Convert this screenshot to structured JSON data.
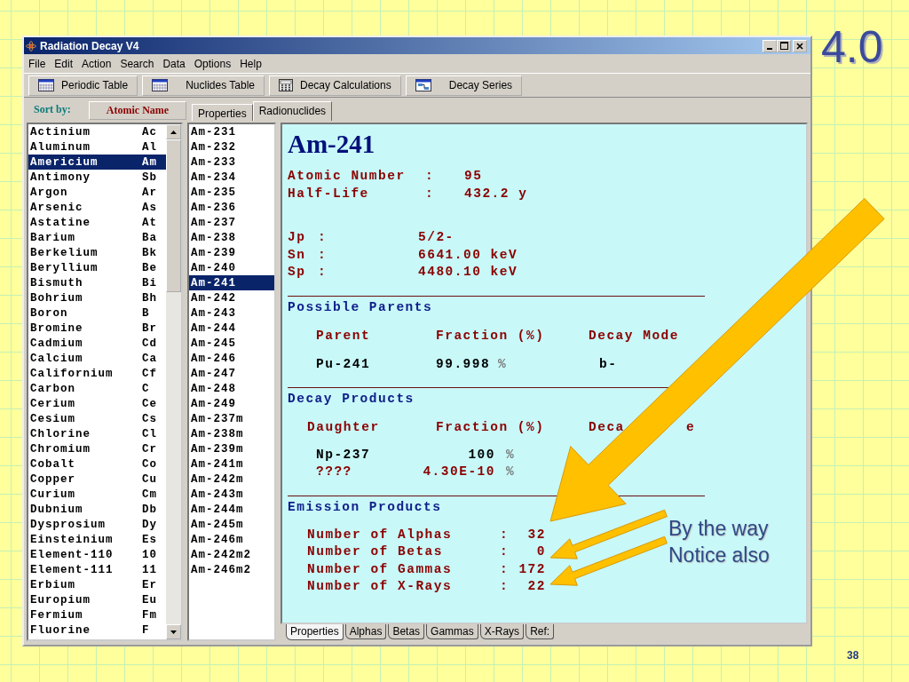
{
  "slide": {
    "heading": "4.0",
    "notes": [
      "By the way",
      "Notice also"
    ],
    "page_number": "38"
  },
  "window": {
    "title": "Radiation Decay V4",
    "menu": [
      "File",
      "Edit",
      "Action",
      "Search",
      "Data",
      "Options",
      "Help"
    ],
    "toolbar": [
      {
        "label": "Periodic Table",
        "kind": "table"
      },
      {
        "label": "Nuclides Table",
        "kind": "table"
      },
      {
        "label": "Decay Calculations",
        "kind": "calculator"
      },
      {
        "label": "Decay Series",
        "kind": "chart"
      }
    ],
    "sort": {
      "label": "Sort by:",
      "button": "Atomic Name"
    },
    "tabs": [
      {
        "label": "Properties",
        "selected": false
      },
      {
        "label": "Radionuclides",
        "selected": true
      }
    ],
    "elements": [
      {
        "name": "Actinium",
        "symbol": "Ac",
        "selected": false
      },
      {
        "name": "Aluminum",
        "symbol": "Al",
        "selected": false
      },
      {
        "name": "Americium",
        "symbol": "Am",
        "selected": true
      },
      {
        "name": "Antimony",
        "symbol": "Sb",
        "selected": false
      },
      {
        "name": "Argon",
        "symbol": "Ar",
        "selected": false
      },
      {
        "name": "Arsenic",
        "symbol": "As",
        "selected": false
      },
      {
        "name": "Astatine",
        "symbol": "At",
        "selected": false
      },
      {
        "name": "Barium",
        "symbol": "Ba",
        "selected": false
      },
      {
        "name": "Berkelium",
        "symbol": "Bk",
        "selected": false
      },
      {
        "name": "Beryllium",
        "symbol": "Be",
        "selected": false
      },
      {
        "name": "Bismuth",
        "symbol": "Bi",
        "selected": false
      },
      {
        "name": "Bohrium",
        "symbol": "Bh",
        "selected": false
      },
      {
        "name": "Boron",
        "symbol": "B",
        "selected": false
      },
      {
        "name": "Bromine",
        "symbol": "Br",
        "selected": false
      },
      {
        "name": "Cadmium",
        "symbol": "Cd",
        "selected": false
      },
      {
        "name": "Calcium",
        "symbol": "Ca",
        "selected": false
      },
      {
        "name": "Californium",
        "symbol": "Cf",
        "selected": false
      },
      {
        "name": "Carbon",
        "symbol": "C",
        "selected": false
      },
      {
        "name": "Cerium",
        "symbol": "Ce",
        "selected": false
      },
      {
        "name": "Cesium",
        "symbol": "Cs",
        "selected": false
      },
      {
        "name": "Chlorine",
        "symbol": "Cl",
        "selected": false
      },
      {
        "name": "Chromium",
        "symbol": "Cr",
        "selected": false
      },
      {
        "name": "Cobalt",
        "symbol": "Co",
        "selected": false
      },
      {
        "name": "Copper",
        "symbol": "Cu",
        "selected": false
      },
      {
        "name": "Curium",
        "symbol": "Cm",
        "selected": false
      },
      {
        "name": "Dubnium",
        "symbol": "Db",
        "selected": false
      },
      {
        "name": "Dysprosium",
        "symbol": "Dy",
        "selected": false
      },
      {
        "name": "Einsteinium",
        "symbol": "Es",
        "selected": false
      },
      {
        "name": "Element-110",
        "symbol": "10",
        "selected": false
      },
      {
        "name": "Element-111",
        "symbol": "11",
        "selected": false
      },
      {
        "name": "Erbium",
        "symbol": "Er",
        "selected": false
      },
      {
        "name": "Europium",
        "symbol": "Eu",
        "selected": false
      },
      {
        "name": "Fermium",
        "symbol": "Fm",
        "selected": false
      },
      {
        "name": "Fluorine",
        "symbol": "F",
        "selected": false
      }
    ],
    "nuclides": [
      {
        "label": "Am-231",
        "selected": false
      },
      {
        "label": "Am-232",
        "selected": false
      },
      {
        "label": "Am-233",
        "selected": false
      },
      {
        "label": "Am-234",
        "selected": false
      },
      {
        "label": "Am-235",
        "selected": false
      },
      {
        "label": "Am-236",
        "selected": false
      },
      {
        "label": "Am-237",
        "selected": false
      },
      {
        "label": "Am-238",
        "selected": false
      },
      {
        "label": "Am-239",
        "selected": false
      },
      {
        "label": "Am-240",
        "selected": false
      },
      {
        "label": "Am-241",
        "selected": true
      },
      {
        "label": "Am-242",
        "selected": false
      },
      {
        "label": "Am-243",
        "selected": false
      },
      {
        "label": "Am-244",
        "selected": false
      },
      {
        "label": "Am-245",
        "selected": false
      },
      {
        "label": "Am-246",
        "selected": false
      },
      {
        "label": "Am-247",
        "selected": false
      },
      {
        "label": "Am-248",
        "selected": false
      },
      {
        "label": "Am-249",
        "selected": false
      },
      {
        "label": "Am-237m",
        "selected": false
      },
      {
        "label": "Am-238m",
        "selected": false
      },
      {
        "label": "Am-239m",
        "selected": false
      },
      {
        "label": "Am-241m",
        "selected": false
      },
      {
        "label": "Am-242m",
        "selected": false
      },
      {
        "label": "Am-243m",
        "selected": false
      },
      {
        "label": "Am-244m",
        "selected": false
      },
      {
        "label": "Am-245m",
        "selected": false
      },
      {
        "label": "Am-246m",
        "selected": false
      },
      {
        "label": "Am-242m2",
        "selected": false
      },
      {
        "label": "Am-246m2",
        "selected": false
      }
    ],
    "detail": {
      "title": "Am-241",
      "properties": [
        {
          "label": "Atomic Number",
          "sep": ":",
          "value": "95"
        },
        {
          "label": "Half-Life",
          "sep": ":",
          "value": "432.2 y"
        }
      ],
      "spin": [
        {
          "label": "Jp",
          "sep": ":",
          "value": "5/2-"
        },
        {
          "label": "Sn",
          "sep": ":",
          "value": "6641.00 keV"
        },
        {
          "label": "Sp",
          "sep": ":",
          "value": "4480.10 keV"
        }
      ],
      "parents": {
        "heading": "Possible Parents",
        "columns": [
          "Parent",
          "Fraction (%)",
          "Decay Mode"
        ],
        "rows": [
          {
            "parent": "Pu-241",
            "fraction": "99.998",
            "unit": "%",
            "mode": "b-"
          }
        ]
      },
      "decay_products": {
        "heading": "Decay Products",
        "columns": [
          "Daughter",
          "Fraction (%)",
          "Deca",
          "e"
        ],
        "rows": [
          {
            "daughter": "Np-237",
            "fraction": "100",
            "unit": "%",
            "unknown": false
          },
          {
            "daughter": "????",
            "fraction": "4.30E-10",
            "unit": "%",
            "unknown": true
          }
        ]
      },
      "emissions": {
        "heading": "Emission Products",
        "rows": [
          {
            "label": "Number of Alphas",
            "sep": ":",
            "value": "32"
          },
          {
            "label": "Number of Betas",
            "sep": ":",
            "value": "0"
          },
          {
            "label": "Number of Gammas",
            "sep": ":",
            "value": "172"
          },
          {
            "label": "Number of X-Rays",
            "sep": ":",
            "value": "22"
          }
        ]
      }
    },
    "bottom_tabs": [
      {
        "label": "Properties",
        "selected": true
      },
      {
        "label": "Alphas",
        "selected": false
      },
      {
        "label": "Betas",
        "selected": false
      },
      {
        "label": "Gammas",
        "selected": false
      },
      {
        "label": "X-Rays",
        "selected": false
      },
      {
        "label": "Ref:",
        "selected": false
      }
    ]
  }
}
